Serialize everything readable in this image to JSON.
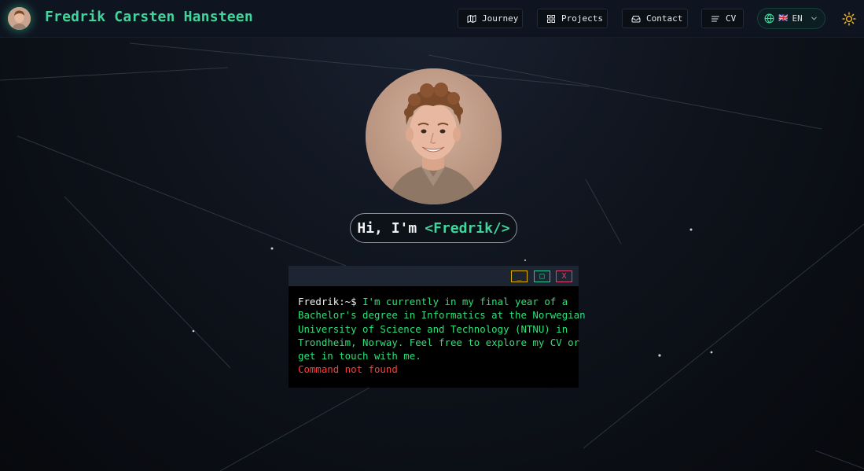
{
  "header": {
    "site_title": "Fredrik Carsten Hansteen",
    "nav": [
      {
        "label": "Journey",
        "icon": "map-icon"
      },
      {
        "label": "Projects",
        "icon": "grid-icon"
      },
      {
        "label": "Contact",
        "icon": "inbox-icon"
      },
      {
        "label": "CV",
        "icon": "lines-icon"
      }
    ],
    "language": {
      "flag": "🇬🇧",
      "label": "EN",
      "icon": "globe-icon"
    },
    "theme_icon": "sun-icon"
  },
  "hero": {
    "greeting_prefix": "Hi, I'm",
    "greeting_name": "<Fredrik/>"
  },
  "terminal": {
    "window_buttons": {
      "minimize": "_",
      "maximize": "□",
      "close": "X"
    },
    "prompt": "Fredrik:~$ ",
    "message_line1": "I'm currently in my final year of a",
    "message_line2": "Bachelor's degree in Informatics at the Norwegian",
    "message_line3": "University of Science and Technology (NTNU) in",
    "message_line4": "Trondheim, Norway. Feel free to explore my CV or",
    "message_line5": "get in touch with me.",
    "error": "Command not found"
  },
  "colors": {
    "accent": "#3fd69b",
    "terminal_text": "#2ee078",
    "error": "#ff3b3b",
    "minimize": "#e0b400",
    "maximize": "#2ec48f",
    "close": "#e0446a"
  }
}
